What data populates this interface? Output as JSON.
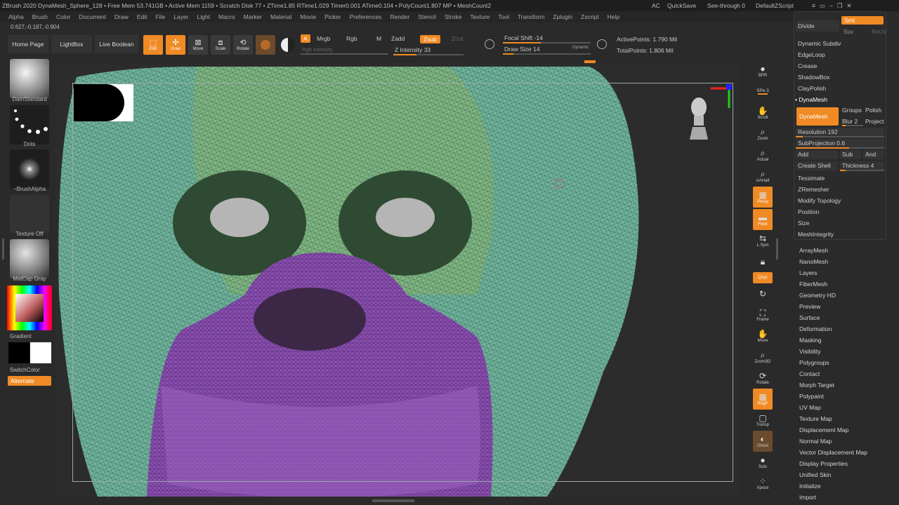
{
  "titlebar": {
    "text": "ZBrush 2020   DynaMesh_Sphere_128   • Free Mem 53.741GB • Active Mem 1159 • Scratch Disk 77 • ZTime1.85 RTime1.029 Timer0.001 ATime0.104 • PolyCount1.807 MP • MeshCount2",
    "ac": "AC",
    "quicksave": "QuickSave",
    "see_through": "See-through",
    "see_through_value": "0",
    "script": "DefaultZScript"
  },
  "menu": [
    "Alpha",
    "Brush",
    "Color",
    "Document",
    "Draw",
    "Edit",
    "File",
    "Layer",
    "Light",
    "Macro",
    "Marker",
    "Material",
    "Movie",
    "Picker",
    "Preferences",
    "Render",
    "Stencil",
    "Stroke",
    "Texture",
    "Tool",
    "Transform",
    "Zplugin",
    "Zscript",
    "Help"
  ],
  "coords": "0.627,-0.187,-0.904",
  "shelf": {
    "home": "Home Page",
    "lightbox": "LightBox",
    "live_boolean": "Live Boolean",
    "edit": "Edit",
    "draw": "Draw",
    "move": "Move",
    "scale": "Scale",
    "rotate": "Rotate",
    "a": "A",
    "mrgb": "Mrgb",
    "rgb": "Rgb",
    "m": "M",
    "zadd": "Zadd",
    "zsub": "Zsub",
    "zcut": "Zcut",
    "rgb_intensity": "Rgb Intensity",
    "z_intensity": "Z Intensity 33",
    "focal_shift": "Focal Shift -14",
    "draw_size": "Draw Size 14",
    "dynamic": "Dynamic",
    "active_points": "ActivePoints: 1.790 Mil",
    "total_points": "TotalPoints: 1.806 Mil"
  },
  "left": {
    "brush": "DamStandard",
    "stroke": "Dots",
    "alpha": "~BrushAlpha",
    "texture": "Texture Off",
    "material": "MatCap Gray",
    "gradient": "Gradient",
    "switchcolor": "SwitchColor",
    "alternate": "Alternate"
  },
  "right_shelf": [
    {
      "label": "BPR",
      "icon": "sphere-icon"
    },
    {
      "label": "SPix 3",
      "icon": "slider-icon"
    },
    {
      "label": "Scroll",
      "icon": "hand-icon"
    },
    {
      "label": "Zoom",
      "icon": "magnifier-icon"
    },
    {
      "label": "Actual",
      "icon": "actual-icon"
    },
    {
      "label": "AAHalf",
      "icon": "aahalf-icon"
    },
    {
      "label": "Persp",
      "icon": "persp-icon"
    },
    {
      "label": "Floor",
      "icon": "floor-icon"
    },
    {
      "label": "L.Sym",
      "icon": "lsym-icon"
    },
    {
      "label": "Lock",
      "icon": "lock-icon"
    },
    {
      "label": "Qxyz",
      "icon": "xyz-icon"
    },
    {
      "label": "Frame",
      "icon": "frame-icon"
    },
    {
      "label": "Move",
      "icon": "move-icon"
    },
    {
      "label": "Zoom3D",
      "icon": "zoom3d-icon"
    },
    {
      "label": "Rotate",
      "icon": "rotate-icon"
    },
    {
      "label": "PolyF",
      "icon": "polyframe-icon"
    },
    {
      "label": "Transp",
      "icon": "transp-icon"
    },
    {
      "label": "Ghost",
      "icon": "ghost-icon"
    },
    {
      "label": "Solo",
      "icon": "solo-icon"
    },
    {
      "label": "Xpose",
      "icon": "xpose-icon"
    }
  ],
  "popup": {
    "divide": "Divide",
    "smt": "Smt",
    "suv": "Suv",
    "reuv": "ReUV",
    "dynamic_subdiv": "Dynamic Subdiv",
    "edgeloop": "EdgeLoop",
    "crease": "Crease",
    "shadowbox": "ShadowBox",
    "claypolish": "ClayPolish",
    "dynamesh_header": "DynaMesh",
    "dynamesh_btn": "DynaMesh",
    "groups": "Groups",
    "polish": "Polish",
    "blur": "Blur 2",
    "project": "Project",
    "resolution": "Resolution 192",
    "subprojection": "SubProjection 0.6",
    "add": "Add",
    "sub": "Sub",
    "and": "And",
    "create_shell": "Create Shell",
    "thickness": "Thickness 4",
    "tessimate": "Tessimate",
    "zremesher": "ZRemesher",
    "modify_topology": "Modify Topology",
    "position": "Position",
    "size": "Size",
    "meshintegrity": "MeshIntegrity"
  },
  "tool_menu": [
    "ArrayMesh",
    "NanoMesh",
    "Layers",
    "FiberMesh",
    "Geometry HD",
    "Preview",
    "Surface",
    "Deformation",
    "Masking",
    "Visibility",
    "Polygroups",
    "Contact",
    "Morph Target",
    "Polypaint",
    "UV Map",
    "Texture Map",
    "Displacement Map",
    "Normal Map",
    "Vector Displacement Map",
    "Display Properties",
    "Unified Skin",
    "Initialize",
    "Import"
  ],
  "colors": {
    "accent": "#f08a24",
    "green_group": "#5fa88f",
    "purple_group": "#8a4fb0",
    "background": "#2a2a2a"
  }
}
